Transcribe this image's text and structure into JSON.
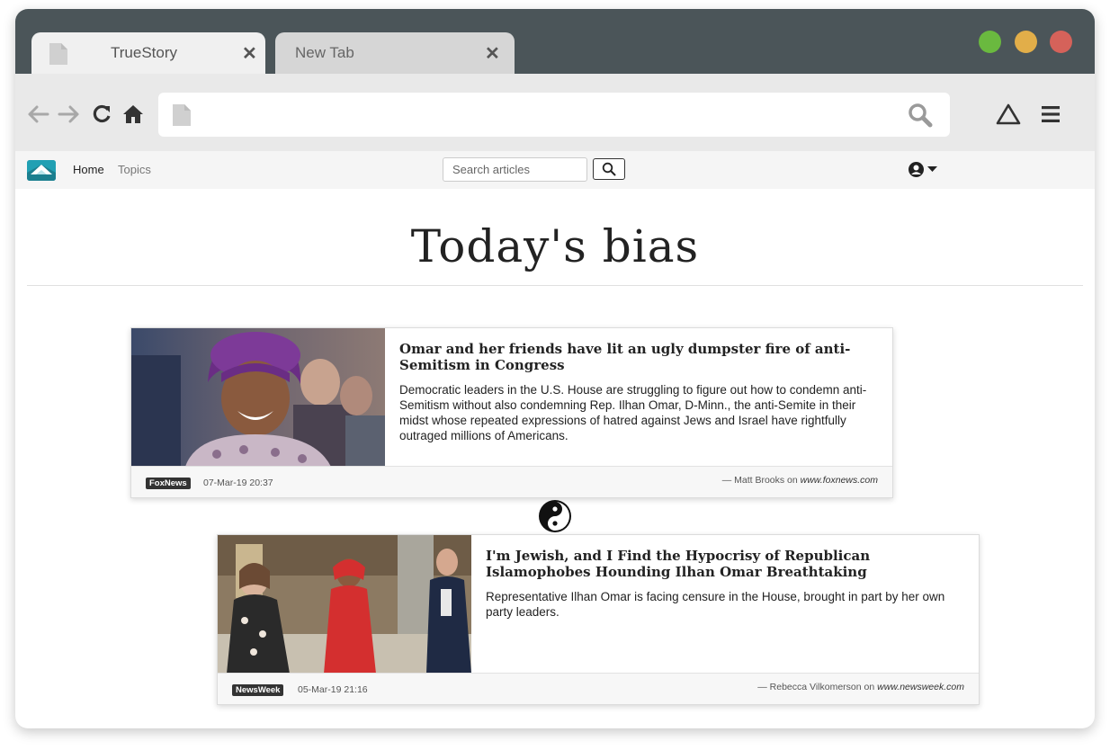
{
  "browser": {
    "tabs": [
      {
        "title": "TrueStory",
        "active": true
      },
      {
        "title": "New Tab",
        "active": false
      }
    ],
    "tab_close_glyph": "✕",
    "window_controls": [
      "#6ab93f",
      "#e2ae49",
      "#d5625a"
    ],
    "toolbar_icons": [
      "back-arrow-icon",
      "forward-arrow-icon",
      "reload-icon",
      "home-icon",
      "search-icon",
      "triangle-icon",
      "menu-icon"
    ],
    "url": ""
  },
  "site": {
    "nav": {
      "home": "Home",
      "topics": "Topics"
    },
    "search_placeholder": "Search articles",
    "icons": [
      "logo-icon",
      "search-icon",
      "user-icon",
      "caret-down-icon"
    ]
  },
  "page": {
    "title": "Today's bias",
    "divider_icon": "yin-yang-icon"
  },
  "articles": [
    {
      "headline": "Omar and her friends have lit an ugly dumpster fire of anti-Semitism in Congress",
      "summary": "Democratic leaders in the U.S. House are struggling to figure out how to condemn anti-Semitism without also condemning Rep. Ilhan Omar, D-Minn., the anti-Semite in their midst whose repeated expressions of hatred against Jews and Israel have rightfully outraged millions of Americans.",
      "source": "FoxNews",
      "date": "07-Mar-19 20:37",
      "author_prefix": "—  Matt Brooks on ",
      "site": "www.foxnews.com"
    },
    {
      "headline": "I'm Jewish, and I Find the Hypocrisy of Republican Islamophobes Hounding Ilhan Omar Breathtaking",
      "summary": "Representative Ilhan Omar is facing censure in the House, brought in part by her own party leaders.",
      "source": "NewsWeek",
      "date": "05-Mar-19 21:16",
      "author_prefix": "—  Rebecca Vilkomerson on ",
      "site": "www.newsweek.com"
    }
  ]
}
